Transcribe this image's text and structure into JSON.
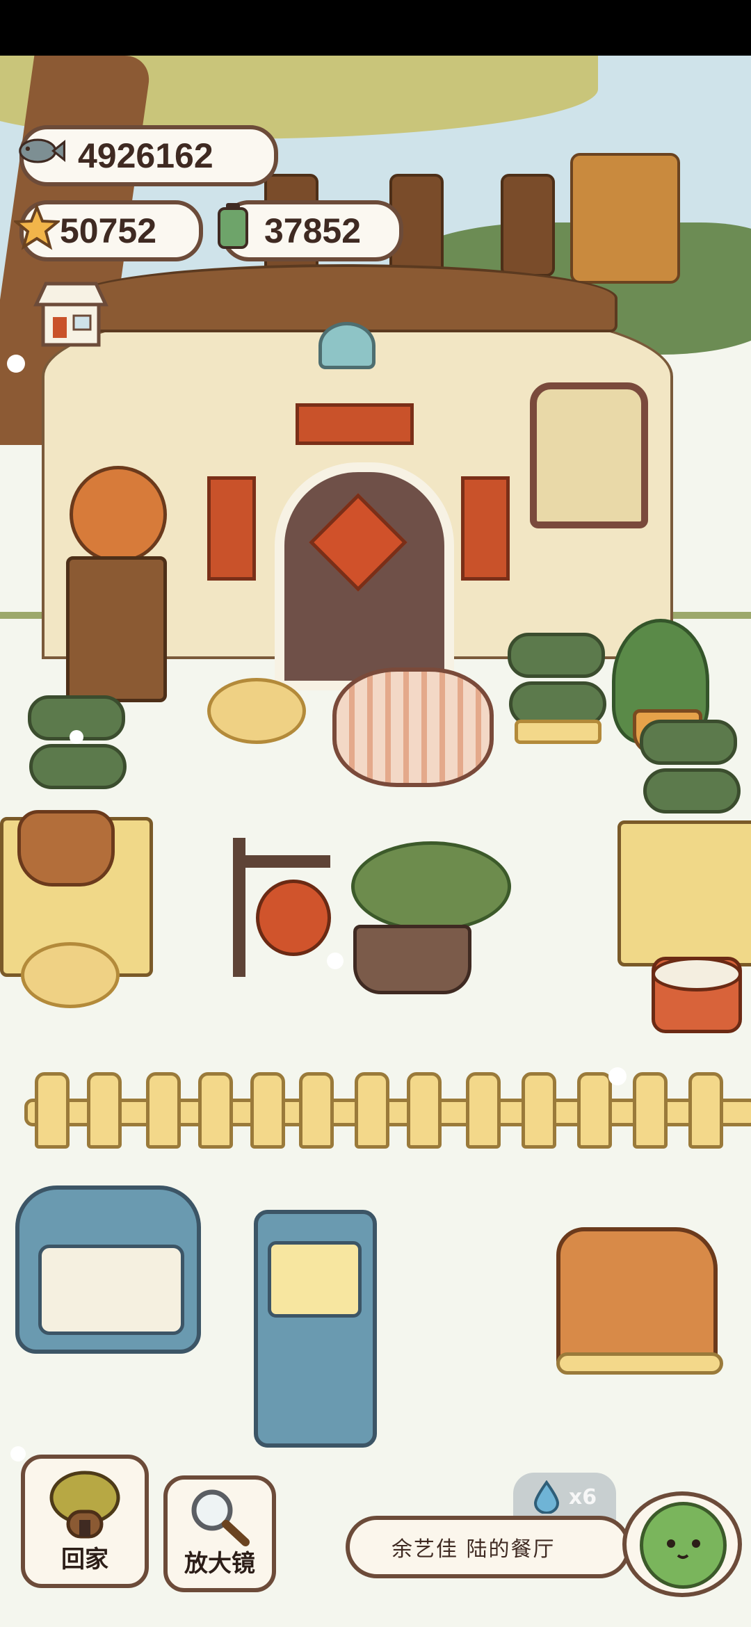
{
  "hud": {
    "fish_count": "4926162",
    "star_count": "50752",
    "battery_count": "37852"
  },
  "bottom": {
    "home_label": "回家",
    "magnifier_label": "放大镜",
    "restaurant_name": "余艺佳 陆的餐厅",
    "drop_count": "x6"
  },
  "icons": {
    "fish": "fish-icon",
    "star": "star-icon",
    "battery": "battery-icon",
    "shop": "shop-icon",
    "drop": "water-drop-icon"
  },
  "colors": {
    "hud_border": "#6c4b39",
    "hud_fill": "#fbf8f1",
    "ground": "#f4f6ee",
    "accent_red": "#d0512a",
    "accent_green": "#5c7a4c"
  }
}
